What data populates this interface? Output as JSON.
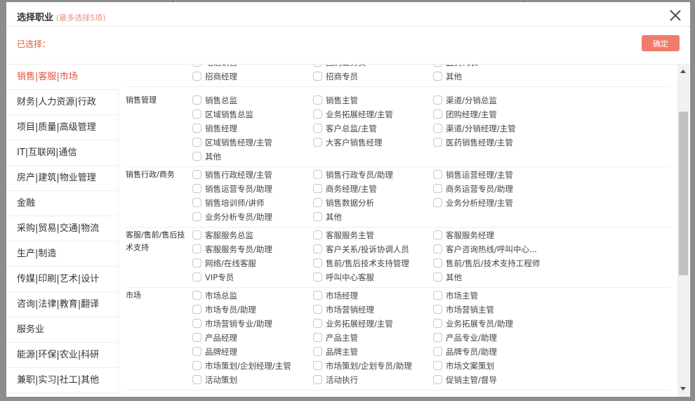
{
  "dialog": {
    "title": "选择职业",
    "subtitle": "(最多选择5项)",
    "selected_label": "已选择：",
    "confirm_label": "确定"
  },
  "sidebar": {
    "items": [
      {
        "label": "销售|客服|市场",
        "active": true
      },
      {
        "label": "财务|人力资源|行政"
      },
      {
        "label": "项目|质量|高级管理"
      },
      {
        "label": "IT|互联网|通信"
      },
      {
        "label": "房产|建筑|物业管理"
      },
      {
        "label": "金融"
      },
      {
        "label": "采购|贸易|交通|物流"
      },
      {
        "label": "生产|制造"
      },
      {
        "label": "传媒|印刷|艺术|设计"
      },
      {
        "label": "咨询|法律|教育|翻译"
      },
      {
        "label": "服务业"
      },
      {
        "label": "能源|环保|农业|科研"
      },
      {
        "label": "兼职|实习|社工|其他"
      }
    ]
  },
  "groups": [
    {
      "name": "",
      "options": [
        "电话销售",
        "团购业务员",
        "医药代表",
        "招商经理",
        "招商专员",
        "其他"
      ]
    },
    {
      "name": "销售管理",
      "options": [
        "销售总监",
        "销售主管",
        "渠道/分销总监",
        "区域销售总监",
        "业务拓展经理/主管",
        "团购经理/主管",
        "销售经理",
        "客户总监/主管",
        "渠道/分销经理/主管",
        "区域销售经理/主管",
        "大客户销售经理",
        "医药销售经理/主管",
        "其他"
      ]
    },
    {
      "name": "销售行政/商务",
      "options": [
        "销售行政经理/主管",
        "销售行政专员/助理",
        "销售运营经理/主管",
        "销售运营专员/助理",
        "商务经理/主管",
        "商务运营专员/助理",
        "销售培训师/讲师",
        "销售数据分析",
        "业务分析经理/主管",
        "业务分析专员/助理",
        "其他"
      ]
    },
    {
      "name": "客服/售前/售后技术支持",
      "options": [
        "客服服务总监",
        "客服服务主管",
        "客服服务经理",
        "客服服务专员/助理",
        "客户关系/投诉协调人员",
        "客户咨询热线/呼叫中心...",
        "网络/在线客服",
        "售前/售后技术支持管理",
        "售前/售后/技术支持工程师",
        "VIP专员",
        "呼叫中心客服",
        "其他"
      ]
    },
    {
      "name": "市场",
      "options": [
        "市场总监",
        "市场经理",
        "市场主管",
        "市场专员/助理",
        "市场营销经理",
        "市场营销主管",
        "市场营销专业/助理",
        "业务拓展经理/主管",
        "业务拓展专员/助理",
        "产品经理",
        "产品主管",
        "产品专业/助理",
        "品牌经理",
        "品牌主管",
        "品牌专员/助理",
        "市场策划/企划经理/主管",
        "市场策划/企划专员/助理",
        "市场文案策划",
        "活动策划",
        "活动执行",
        "促销主管/督导"
      ]
    }
  ]
}
